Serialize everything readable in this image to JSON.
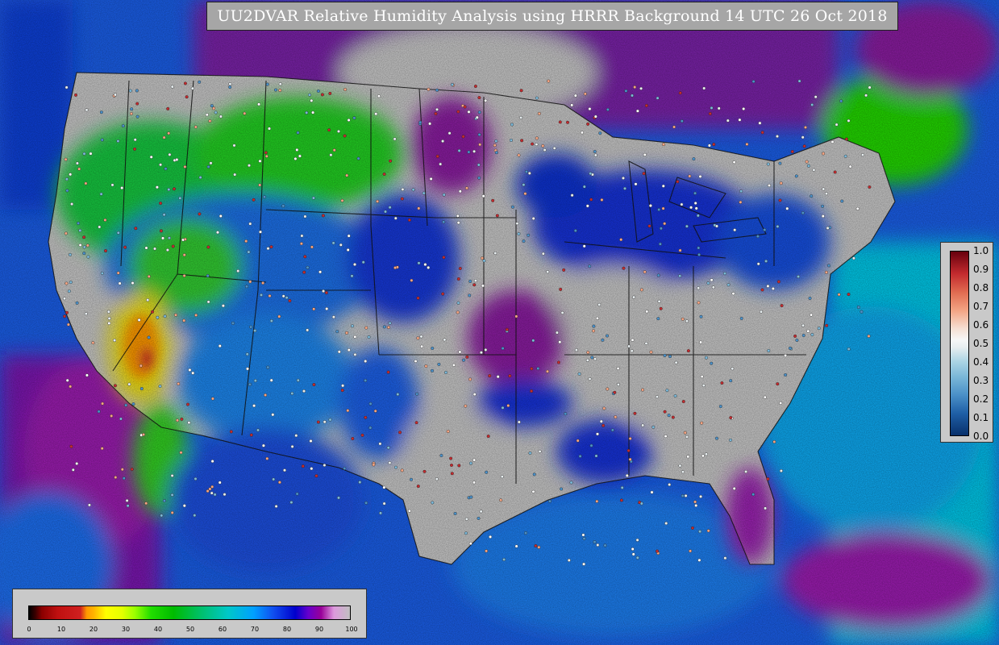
{
  "map": {
    "title": "UU2DVAR Relative Humidity Analysis using HRRR Background 14 UTC 26 Oct 2018",
    "colorbar": {
      "ticks": [
        "0",
        "10",
        "20",
        "30",
        "40",
        "50",
        "60",
        "70",
        "80",
        "90",
        "100"
      ]
    },
    "station_legend": {
      "ticks": [
        "1.0",
        "0.9",
        "0.8",
        "0.7",
        "0.6",
        "0.5",
        "0.4",
        "0.3",
        "0.2",
        "0.1",
        "0.0"
      ]
    },
    "colors": {
      "ocean_east": "#00c8e8",
      "ocean_deep": "#1050f0",
      "land_dry": "#c8c8c8",
      "humid_purple": "#8a1aa0",
      "mid_green": "#00c800",
      "dry_yellow": "#ffd000",
      "dry_red": "#d02020"
    }
  }
}
